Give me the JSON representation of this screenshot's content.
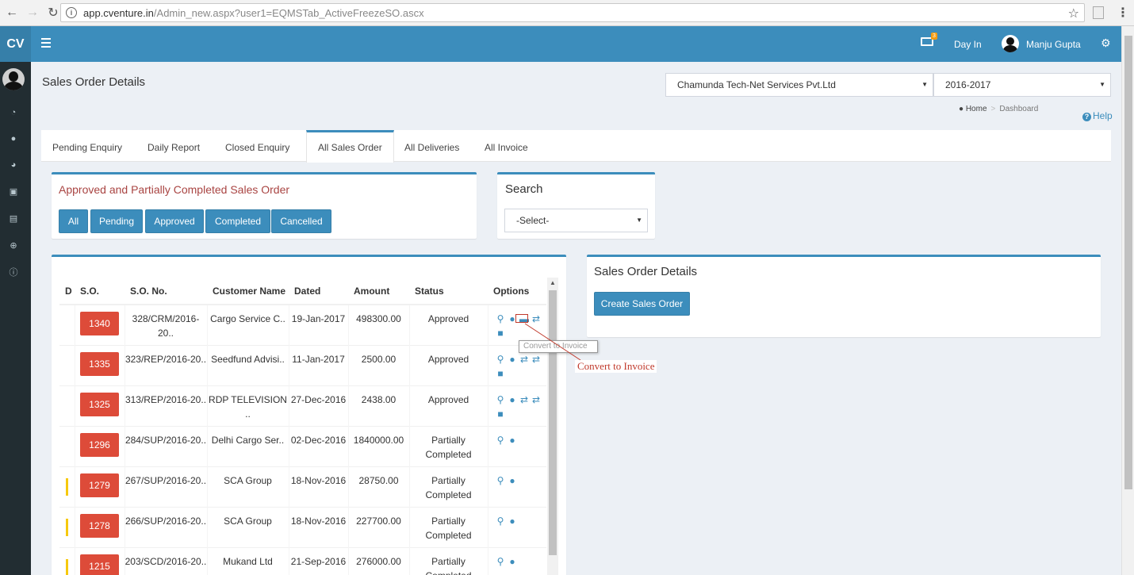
{
  "browser": {
    "url_host": "app.cventure.in",
    "url_path": "/Admin_new.aspx?user1=EQMSTab_ActiveFreezeSO.ascx"
  },
  "header": {
    "logo": "CV",
    "cash_badge": "3",
    "day_in": "Day In",
    "user_name": "Manju Gupta"
  },
  "page": {
    "title": "Sales Order Details",
    "company_select": "Chamunda Tech-Net Services Pvt.Ltd",
    "year_select": "2016-2017",
    "breadcrumb_home": "Home",
    "breadcrumb_current": "Dashboard",
    "help": "Help"
  },
  "tabs": [
    "Pending Enquiry",
    "Daily Report",
    "Closed Enquiry",
    "All Sales Order",
    "All Deliveries",
    "All Invoice"
  ],
  "filter_box": {
    "title": "Approved and Partially Completed Sales Order",
    "buttons": [
      "All",
      "Pending",
      "Approved",
      "Completed",
      "Cancelled"
    ]
  },
  "search_box": {
    "title": "Search",
    "select": "-Select-"
  },
  "details_box": {
    "title": "Sales Order Details",
    "create_button": "Create Sales Order"
  },
  "table": {
    "headers": [
      "D",
      "S.O.",
      "S.O. No.",
      "Customer Name",
      "Dated",
      "Amount",
      "Status",
      "Options"
    ],
    "rows": [
      {
        "so": "1340",
        "so_no": "328/CRM/2016-20..",
        "customer": "Cargo Service C..",
        "dated": "19-Jan-2017",
        "amount": "498300.00",
        "status": "Approved"
      },
      {
        "so": "1335",
        "so_no": "323/REP/2016-20..",
        "customer": "Seedfund Advisi..",
        "dated": "11-Jan-2017",
        "amount": "2500.00",
        "status": "Approved"
      },
      {
        "so": "1325",
        "so_no": "313/REP/2016-20..",
        "customer": "RDP TELEVISION ..",
        "dated": "27-Dec-2016",
        "amount": "2438.00",
        "status": "Approved"
      },
      {
        "so": "1296",
        "so_no": "284/SUP/2016-20..",
        "customer": "Delhi Cargo Ser..",
        "dated": "02-Dec-2016",
        "amount": "1840000.00",
        "status": "Partially Completed"
      },
      {
        "so": "1279",
        "so_no": "267/SUP/2016-20..",
        "customer": "SCA Group",
        "dated": "18-Nov-2016",
        "amount": "28750.00",
        "status": "Partially Completed"
      },
      {
        "so": "1278",
        "so_no": "266/SUP/2016-20..",
        "customer": "SCA Group",
        "dated": "18-Nov-2016",
        "amount": "227700.00",
        "status": "Partially Completed"
      },
      {
        "so": "1215",
        "so_no": "203/SCD/2016-20..",
        "customer": "Mukand Ltd",
        "dated": "21-Sep-2016",
        "amount": "276000.00",
        "status": "Partially Completed"
      }
    ]
  },
  "tooltip": "Convert to Invoice",
  "callout": "Convert to Invoice",
  "colors": {
    "primary": "#3c8dbc",
    "header": "#3c8dbc",
    "sidebar": "#222d32",
    "danger": "#dd4b39",
    "warning": "#f39c12",
    "title_red": "#a94442"
  },
  "icons": {
    "sidebar": [
      "dashboard-icon",
      "user-icon",
      "pie-chart-icon",
      "cart-icon",
      "credit-card-icon",
      "globe-icon",
      "info-icon"
    ],
    "options": [
      "search-icon",
      "comment-icon",
      "invoice-icon",
      "exchange-icon",
      "trash-icon"
    ]
  }
}
